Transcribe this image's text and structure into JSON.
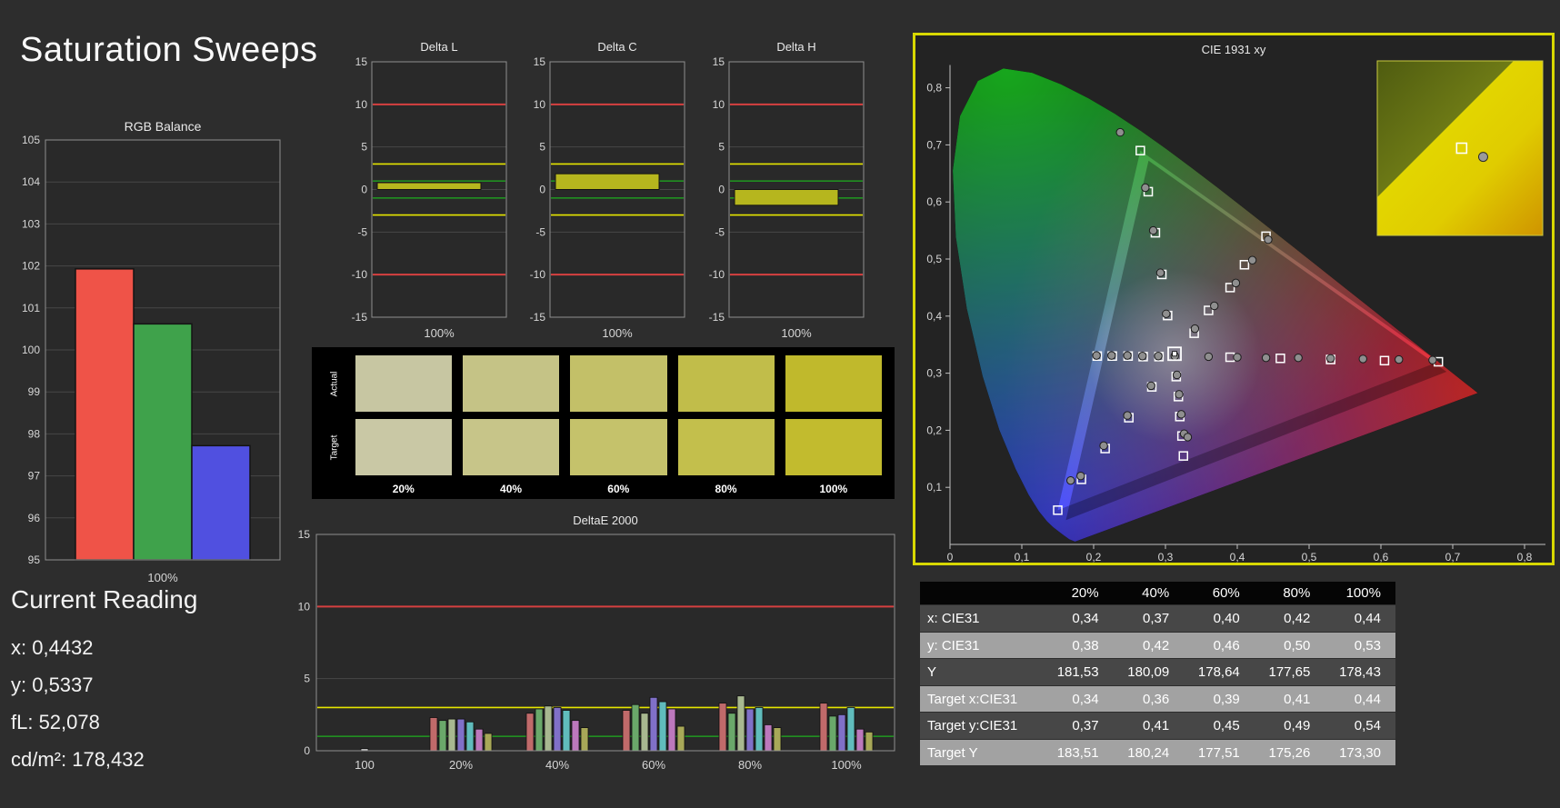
{
  "page": {
    "title": "Saturation Sweeps",
    "background": "#2d2d2d"
  },
  "current_reading": {
    "heading": "Current Reading",
    "lines": [
      "x: 0,4432",
      "y: 0,5337",
      "fL: 52,078",
      "cd/m²: 178,432"
    ]
  },
  "swatches": {
    "row_labels": [
      "Actual",
      "Target"
    ],
    "col_labels": [
      "20%",
      "40%",
      "60%",
      "80%",
      "100%"
    ],
    "actual_colors": [
      "#c7c6a2",
      "#c5c386",
      "#c3c068",
      "#c1bd4a",
      "#c0b92c"
    ],
    "target_colors": [
      "#c9c8a5",
      "#c7c589",
      "#c5c26b",
      "#c3bf4c",
      "#c2bb2e"
    ]
  },
  "table": {
    "corner": "",
    "col_headers": [
      "20%",
      "40%",
      "60%",
      "80%",
      "100%"
    ],
    "rows": [
      {
        "label": "x: CIE31",
        "values": [
          "0,34",
          "0,37",
          "0,40",
          "0,42",
          "0,44"
        ],
        "shade": "dark"
      },
      {
        "label": "y: CIE31",
        "values": [
          "0,38",
          "0,42",
          "0,46",
          "0,50",
          "0,53"
        ],
        "shade": "light"
      },
      {
        "label": "Y",
        "values": [
          "181,53",
          "180,09",
          "178,64",
          "177,65",
          "178,43"
        ],
        "shade": "dark"
      },
      {
        "label": "Target x:CIE31",
        "values": [
          "0,34",
          "0,36",
          "0,39",
          "0,41",
          "0,44"
        ],
        "shade": "light"
      },
      {
        "label": "Target y:CIE31",
        "values": [
          "0,37",
          "0,41",
          "0,45",
          "0,49",
          "0,54"
        ],
        "shade": "dark"
      },
      {
        "label": "Target Y",
        "values": [
          "183,51",
          "180,24",
          "177,51",
          "175,26",
          "173,30"
        ],
        "shade": "light"
      }
    ]
  },
  "chart_data": [
    {
      "id": "rgb_balance",
      "type": "bar",
      "title": "RGB Balance",
      "categories": [
        "100%"
      ],
      "series": [
        {
          "name": "red",
          "color": "#ef5348",
          "values": [
            101.93
          ]
        },
        {
          "name": "green",
          "color": "#3fa24b",
          "values": [
            100.62
          ]
        },
        {
          "name": "blue",
          "color": "#5050e0",
          "values": [
            97.72
          ]
        }
      ],
      "ylim": [
        95,
        105
      ],
      "ytick_step": 1,
      "grid": true
    },
    {
      "id": "delta_l",
      "type": "bar",
      "title": "Delta L",
      "categories": [
        "100%"
      ],
      "values": [
        0.8
      ],
      "bar_color": "#b6b61e",
      "ylim": [
        -15,
        15
      ],
      "yticks": [
        15,
        10,
        5,
        0,
        -5,
        -10,
        -15
      ],
      "ref_lines": [
        {
          "y": 10,
          "color": "#d64040",
          "width": 2
        },
        {
          "y": -10,
          "color": "#d64040",
          "width": 2
        },
        {
          "y": 3,
          "color": "#e6e600",
          "width": 1.6
        },
        {
          "y": -3,
          "color": "#e6e600",
          "width": 1.6
        },
        {
          "y": 1,
          "color": "#1faf1f",
          "width": 1.2
        },
        {
          "y": -1,
          "color": "#1faf1f",
          "width": 1.2
        }
      ]
    },
    {
      "id": "delta_c",
      "type": "bar",
      "title": "Delta C",
      "categories": [
        "100%"
      ],
      "values": [
        1.85
      ],
      "bar_color": "#b6b61e",
      "ylim": [
        -15,
        15
      ],
      "yticks": [
        15,
        10,
        5,
        0,
        -5,
        -10,
        -15
      ],
      "ref_lines": [
        {
          "y": 10,
          "color": "#d64040",
          "width": 2
        },
        {
          "y": -10,
          "color": "#d64040",
          "width": 2
        },
        {
          "y": 3,
          "color": "#e6e600",
          "width": 1.6
        },
        {
          "y": -3,
          "color": "#e6e600",
          "width": 1.6
        },
        {
          "y": 1,
          "color": "#1faf1f",
          "width": 1.2
        },
        {
          "y": -1,
          "color": "#1faf1f",
          "width": 1.2
        }
      ]
    },
    {
      "id": "delta_h",
      "type": "bar",
      "title": "Delta H",
      "categories": [
        "100%"
      ],
      "values": [
        -1.85
      ],
      "bar_color": "#b6b61e",
      "ylim": [
        -15,
        15
      ],
      "yticks": [
        15,
        10,
        5,
        0,
        -5,
        -10,
        -15
      ],
      "ref_lines": [
        {
          "y": 10,
          "color": "#d64040",
          "width": 2
        },
        {
          "y": -10,
          "color": "#d64040",
          "width": 2
        },
        {
          "y": 3,
          "color": "#e6e600",
          "width": 1.6
        },
        {
          "y": -3,
          "color": "#e6e600",
          "width": 1.6
        },
        {
          "y": 1,
          "color": "#1faf1f",
          "width": 1.2
        },
        {
          "y": -1,
          "color": "#1faf1f",
          "width": 1.2
        }
      ]
    },
    {
      "id": "deltae_2000",
      "type": "bar",
      "title": "DeltaE 2000",
      "ylim": [
        0,
        15
      ],
      "yticks": [
        0,
        5,
        10,
        15
      ],
      "ref_lines": [
        {
          "y": 10,
          "color": "#d64040",
          "width": 2
        },
        {
          "y": 3,
          "color": "#e6e600",
          "width": 1.6
        },
        {
          "y": 1,
          "color": "#1faf1f",
          "width": 1.2
        }
      ],
      "groups": [
        {
          "label": "100",
          "bars": [
            {
              "color": "#b8b8b8",
              "value": 0.15
            }
          ]
        },
        {
          "label": "20%",
          "bars": [
            {
              "color": "#c06a6a",
              "value": 2.3
            },
            {
              "color": "#6aa86a",
              "value": 2.1
            },
            {
              "color": "#a8b890",
              "value": 2.2
            },
            {
              "color": "#8070c8",
              "value": 2.2
            },
            {
              "color": "#60bcbc",
              "value": 2.0
            },
            {
              "color": "#bc78bc",
              "value": 1.5
            },
            {
              "color": "#a8a858",
              "value": 1.2
            }
          ]
        },
        {
          "label": "40%",
          "bars": [
            {
              "color": "#c06a6a",
              "value": 2.6
            },
            {
              "color": "#6aa86a",
              "value": 2.9
            },
            {
              "color": "#a8b890",
              "value": 3.1
            },
            {
              "color": "#8070c8",
              "value": 3.0
            },
            {
              "color": "#60bcbc",
              "value": 2.8
            },
            {
              "color": "#bc78bc",
              "value": 2.1
            },
            {
              "color": "#a8a858",
              "value": 1.6
            }
          ]
        },
        {
          "label": "60%",
          "bars": [
            {
              "color": "#c06a6a",
              "value": 2.8
            },
            {
              "color": "#6aa86a",
              "value": 3.2
            },
            {
              "color": "#a8b890",
              "value": 2.6
            },
            {
              "color": "#8070c8",
              "value": 3.7
            },
            {
              "color": "#60bcbc",
              "value": 3.4
            },
            {
              "color": "#bc78bc",
              "value": 2.9
            },
            {
              "color": "#a8a858",
              "value": 1.7
            }
          ]
        },
        {
          "label": "80%",
          "bars": [
            {
              "color": "#c06a6a",
              "value": 3.3
            },
            {
              "color": "#6aa86a",
              "value": 2.6
            },
            {
              "color": "#a8b890",
              "value": 3.8
            },
            {
              "color": "#8070c8",
              "value": 2.9
            },
            {
              "color": "#60bcbc",
              "value": 3.0
            },
            {
              "color": "#bc78bc",
              "value": 1.8
            },
            {
              "color": "#a8a858",
              "value": 1.6
            }
          ]
        },
        {
          "label": "100%",
          "bars": [
            {
              "color": "#c06a6a",
              "value": 3.3
            },
            {
              "color": "#6aa86a",
              "value": 2.4
            },
            {
              "color": "#8070c8",
              "value": 2.5
            },
            {
              "color": "#60bcbc",
              "value": 3.0
            },
            {
              "color": "#bc78bc",
              "value": 1.5
            },
            {
              "color": "#a8a858",
              "value": 1.3
            }
          ]
        }
      ]
    },
    {
      "id": "cie_1931",
      "type": "scatter",
      "title": "CIE 1931 xy",
      "xlim": [
        0,
        0.84
      ],
      "ylim": [
        0,
        0.84
      ],
      "xticks": [
        {
          "v": 0,
          "label": "0"
        },
        {
          "v": 0.1,
          "label": "0,1"
        },
        {
          "v": 0.2,
          "label": "0,2"
        },
        {
          "v": 0.3,
          "label": "0,3"
        },
        {
          "v": 0.4,
          "label": "0,4"
        },
        {
          "v": 0.5,
          "label": "0,5"
        },
        {
          "v": 0.6,
          "label": "0,6"
        },
        {
          "v": 0.7,
          "label": "0,7"
        },
        {
          "v": 0.8,
          "label": "0,8"
        }
      ],
      "yticks": [
        {
          "v": 0.1,
          "label": "0,1"
        },
        {
          "v": 0.2,
          "label": "0,2"
        },
        {
          "v": 0.3,
          "label": "0,3"
        },
        {
          "v": 0.4,
          "label": "0,4"
        },
        {
          "v": 0.5,
          "label": "0,5"
        },
        {
          "v": 0.6,
          "label": "0,6"
        },
        {
          "v": 0.7,
          "label": "0,7"
        },
        {
          "v": 0.8,
          "label": "0,8"
        }
      ],
      "gamut_triangle": [
        [
          0.68,
          0.32
        ],
        [
          0.265,
          0.69
        ],
        [
          0.15,
          0.06
        ]
      ],
      "target_points": [
        [
          0.39,
          0.328
        ],
        [
          0.46,
          0.326
        ],
        [
          0.53,
          0.324
        ],
        [
          0.605,
          0.322
        ],
        [
          0.68,
          0.32
        ],
        [
          0.303,
          0.401
        ],
        [
          0.295,
          0.473
        ],
        [
          0.286,
          0.546
        ],
        [
          0.276,
          0.618
        ],
        [
          0.265,
          0.69
        ],
        [
          0.281,
          0.276
        ],
        [
          0.249,
          0.222
        ],
        [
          0.216,
          0.168
        ],
        [
          0.183,
          0.114
        ],
        [
          0.15,
          0.06
        ],
        [
          0.291,
          0.329
        ],
        [
          0.269,
          0.329
        ],
        [
          0.248,
          0.33
        ],
        [
          0.226,
          0.33
        ],
        [
          0.205,
          0.33
        ],
        [
          0.315,
          0.294
        ],
        [
          0.318,
          0.259
        ],
        [
          0.32,
          0.224
        ],
        [
          0.323,
          0.19
        ],
        [
          0.325,
          0.155
        ],
        [
          0.34,
          0.37
        ],
        [
          0.36,
          0.41
        ],
        [
          0.39,
          0.45
        ],
        [
          0.41,
          0.49
        ],
        [
          0.44,
          0.54
        ]
      ],
      "measured_points": [
        [
          0.36,
          0.329
        ],
        [
          0.4,
          0.328
        ],
        [
          0.44,
          0.327
        ],
        [
          0.485,
          0.327
        ],
        [
          0.53,
          0.326
        ],
        [
          0.575,
          0.325
        ],
        [
          0.625,
          0.324
        ],
        [
          0.672,
          0.323
        ],
        [
          0.301,
          0.404
        ],
        [
          0.293,
          0.476
        ],
        [
          0.283,
          0.55
        ],
        [
          0.272,
          0.625
        ],
        [
          0.237,
          0.722
        ],
        [
          0.28,
          0.278
        ],
        [
          0.247,
          0.226
        ],
        [
          0.214,
          0.173
        ],
        [
          0.182,
          0.12
        ],
        [
          0.168,
          0.112
        ],
        [
          0.29,
          0.33
        ],
        [
          0.268,
          0.33
        ],
        [
          0.247,
          0.331
        ],
        [
          0.225,
          0.331
        ],
        [
          0.204,
          0.331
        ],
        [
          0.316,
          0.297
        ],
        [
          0.319,
          0.263
        ],
        [
          0.322,
          0.228
        ],
        [
          0.326,
          0.194
        ],
        [
          0.331,
          0.188
        ],
        [
          0.341,
          0.378
        ],
        [
          0.368,
          0.418
        ],
        [
          0.398,
          0.458
        ],
        [
          0.421,
          0.498
        ],
        [
          0.443,
          0.534
        ],
        [
          0.313,
          0.33
        ]
      ],
      "selected_point": [
        0.3127,
        0.334
      ],
      "inset": {
        "square": [
          0.51,
          0.5
        ],
        "circle": [
          0.64,
          0.55
        ]
      }
    }
  ]
}
